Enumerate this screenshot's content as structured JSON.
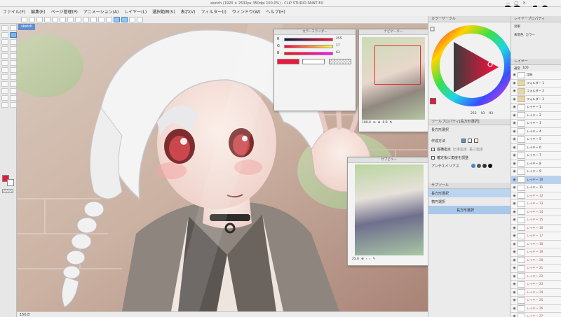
{
  "titlebar": {
    "title": "sketch (1920 × 2532px 350dpi 100.0%) - CLIP STUDIO PAINT EX",
    "controls": [
      "—",
      "□",
      "✕"
    ]
  },
  "clock": "22:10",
  "menu": [
    "ファイル(F)",
    "編集(E)",
    "ページ管理(P)",
    "アニメーション(A)",
    "レイヤー(L)",
    "選択範囲(S)",
    "表示(V)",
    "フィルター(I)",
    "ウィンドウ(W)",
    "ヘルプ(H)"
  ],
  "canvas": {
    "tab": "sketch",
    "status": "150.8"
  },
  "colorslider": {
    "title": "カラースライダー",
    "rows": [
      {
        "label": "R",
        "value": "255"
      },
      {
        "label": "G",
        "value": "17"
      },
      {
        "label": "B",
        "value": "63"
      }
    ],
    "current_color": "#e8193c"
  },
  "navigator": {
    "title": "ナビゲーター",
    "zoom": "100.0",
    "angle": "0.0"
  },
  "subview": {
    "title": "サブビュー",
    "zoom": "25.0"
  },
  "colorwheel": {
    "tab": "カラーサークル",
    "h": "253",
    "s": "93",
    "v": "93",
    "current_color": "#e8193c"
  },
  "tool_property": {
    "tab": "ツールプロパティ[長方形選択]",
    "tool_name": "長方形選択",
    "rows": [
      {
        "label": "作成方法"
      },
      {
        "label": "縦横指定",
        "opt1": "比率指定",
        "opt2": "長さ指定"
      },
      {
        "label": "確定後に角度を調整"
      },
      {
        "label": "アンチエイリアス"
      }
    ]
  },
  "sub_tool": {
    "tab": "サブツール",
    "items": [
      "長方形選択",
      "楕円選択",
      "長方形選択"
    ]
  },
  "layer_property": {
    "tab": "レイヤープロパティ",
    "effect": "効果",
    "expression": "表現色",
    "expression_value": "カラー"
  },
  "layer_panel": {
    "tab": "レイヤー",
    "blend": "通常",
    "opacity": "100",
    "layers": [
      {
        "name": "用紙",
        "type": "normal"
      },
      {
        "name": "フォルダー 1",
        "type": "folder"
      },
      {
        "name": "フォルダー 2",
        "type": "folder"
      },
      {
        "name": "フォルダー 3",
        "type": "folder"
      },
      {
        "name": "レイヤー 1",
        "type": "normal"
      },
      {
        "name": "レイヤー 2",
        "type": "normal"
      },
      {
        "name": "レイヤー 3",
        "type": "normal"
      },
      {
        "name": "レイヤー 4",
        "type": "normal"
      },
      {
        "name": "レイヤー 5",
        "type": "normal"
      },
      {
        "name": "レイヤー 6",
        "type": "normal"
      },
      {
        "name": "レイヤー 7",
        "type": "normal"
      },
      {
        "name": "レイヤー 8",
        "type": "normal"
      },
      {
        "name": "レイヤー 9",
        "type": "normal"
      },
      {
        "name": "レイヤー 10",
        "type": "selected"
      },
      {
        "name": "レイヤー 11",
        "type": "normal"
      },
      {
        "name": "レイヤー 12",
        "type": "red"
      },
      {
        "name": "レイヤー 13",
        "type": "red"
      },
      {
        "name": "レイヤー 14",
        "type": "red"
      },
      {
        "name": "レイヤー 15",
        "type": "red"
      },
      {
        "name": "レイヤー 16",
        "type": "red"
      },
      {
        "name": "レイヤー 17",
        "type": "red"
      },
      {
        "name": "レイヤー 18",
        "type": "red"
      },
      {
        "name": "レイヤー 19",
        "type": "red"
      },
      {
        "name": "レイヤー 20",
        "type": "red"
      },
      {
        "name": "レイヤー 21",
        "type": "red"
      },
      {
        "name": "レイヤー 22",
        "type": "red"
      },
      {
        "name": "レイヤー 23",
        "type": "red"
      },
      {
        "name": "レイヤー 24",
        "type": "red"
      },
      {
        "name": "レイヤー 25",
        "type": "red"
      },
      {
        "name": "レイヤー 26",
        "type": "red"
      },
      {
        "name": "レイヤー 27",
        "type": "red"
      }
    ]
  },
  "colors": {
    "accent": "#4a86c5",
    "primary": "#e8193c"
  }
}
